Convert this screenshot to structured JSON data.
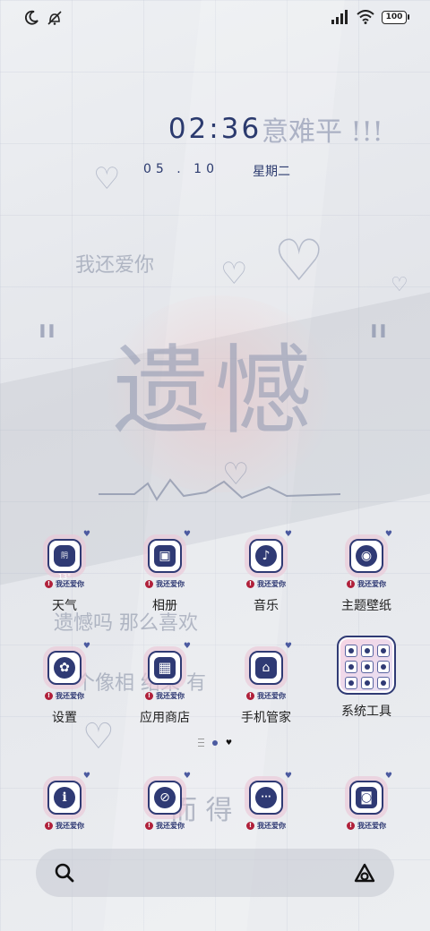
{
  "status_bar": {
    "left_icons": [
      "moon-icon",
      "mute-icon"
    ],
    "right_icons": [
      "signal-icon",
      "wifi-icon",
      "battery-icon"
    ],
    "battery": "100"
  },
  "lockscreen": {
    "time": "02:36",
    "date": "05 . 10",
    "weekday": "星期二"
  },
  "wallpaper_text": {
    "title_tail": "意难平 !!!",
    "line1": "我还爱你",
    "big_word": "遗憾",
    "line2": "遗憾吗 那么喜欢",
    "line3": "一个像相 结果 有",
    "line4": "而 得"
  },
  "icon_tag": "我还爱你",
  "apps_row1": [
    {
      "label": "天气",
      "glyph": "阴 13°",
      "icon": "weather-icon"
    },
    {
      "label": "相册",
      "glyph": "▣",
      "icon": "gallery-icon"
    },
    {
      "label": "音乐",
      "glyph": "♪",
      "icon": "music-icon"
    },
    {
      "label": "主题壁纸",
      "glyph": "◉",
      "icon": "themes-icon"
    }
  ],
  "apps_row2": [
    {
      "label": "设置",
      "glyph": "✿",
      "icon": "settings-icon"
    },
    {
      "label": "应用商店",
      "glyph": "▦",
      "icon": "app-store-icon"
    },
    {
      "label": "手机管家",
      "glyph": "⌂",
      "icon": "security-icon"
    },
    {
      "label": "系统工具",
      "icon": "folder-icon"
    }
  ],
  "dock": [
    {
      "glyph": "i",
      "icon": "info-icon"
    },
    {
      "glyph": "⊘",
      "icon": "browser-icon"
    },
    {
      "glyph": "···",
      "icon": "messages-icon"
    },
    {
      "glyph": "◙",
      "icon": "camera-icon"
    }
  ],
  "colors": {
    "accent": "#2f3a74",
    "tag_red": "#b0203a",
    "pink_glow": "#ebc8d7"
  }
}
